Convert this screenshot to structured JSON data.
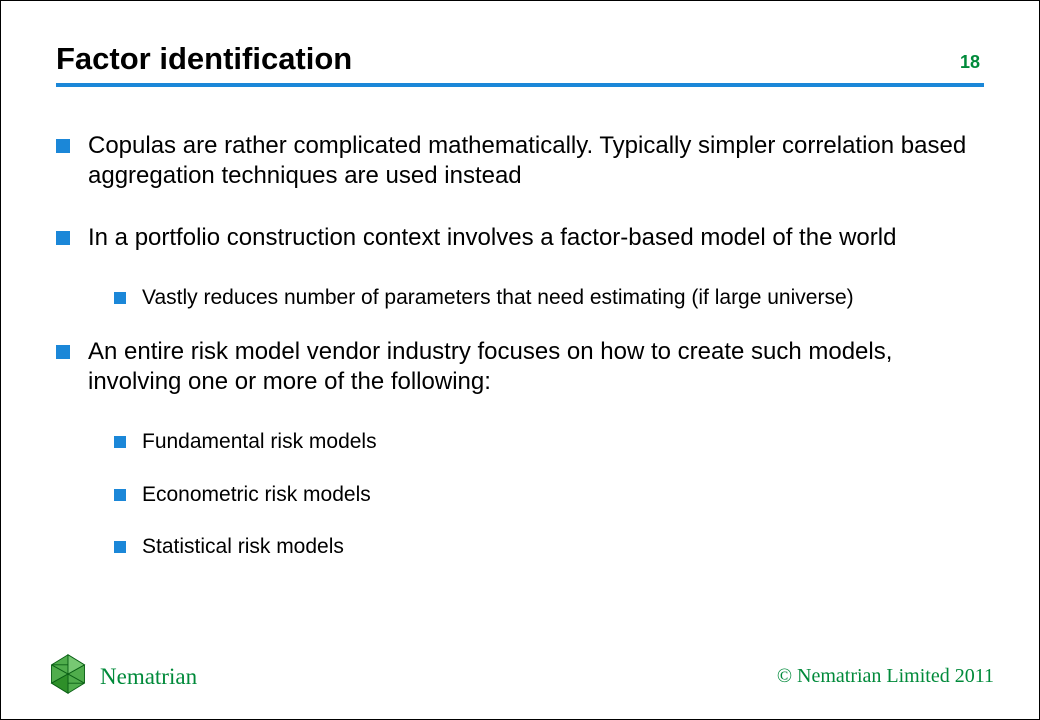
{
  "header": {
    "title": "Factor identification",
    "page_number": "18"
  },
  "bullets": [
    "Copulas are rather complicated mathematically. Typically simpler correlation based aggregation techniques are used instead",
    "In a portfolio construction context involves a factor-based model of the world",
    "An entire risk model vendor industry focuses on how to create such models, involving one or more of the following:"
  ],
  "sub_after_1": [
    "Vastly reduces number of parameters that need estimating (if large universe)"
  ],
  "sub_after_2": [
    "Fundamental risk models",
    "Econometric risk models",
    "Statistical risk models"
  ],
  "footer": {
    "brand": "Nematrian",
    "copyright": "© Nematrian Limited 2011"
  },
  "colors": {
    "accent_blue": "#1b87d8",
    "accent_green": "#008a3a"
  }
}
